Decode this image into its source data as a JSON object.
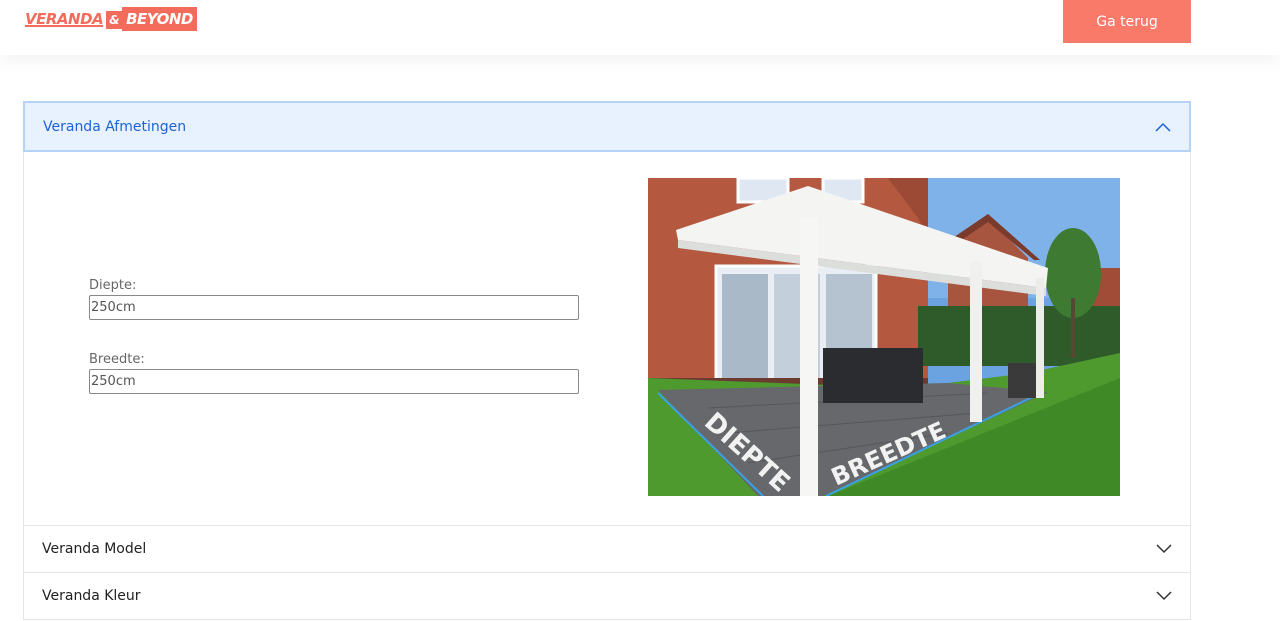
{
  "header": {
    "logo": {
      "part1": "VERANDA",
      "amp": "&",
      "part2": "BEYOND"
    },
    "back_button": "Ga terug",
    "accent": "#fa7a6a"
  },
  "accordion": {
    "sections": [
      {
        "title": "Veranda Afmetingen",
        "state": "open",
        "icon": "chevron-up-icon"
      },
      {
        "title": "Veranda Model",
        "state": "closed",
        "icon": "chevron-down-icon"
      },
      {
        "title": "Veranda Kleur",
        "state": "closed",
        "icon": "chevron-down-icon"
      }
    ],
    "dimensions": {
      "depth_label": "Diepte:",
      "depth_value": "250cm",
      "width_label": "Breedte:",
      "width_value": "250cm"
    },
    "photo": {
      "depth_text": "DIEPTE",
      "width_text": "BREEDTE"
    }
  }
}
